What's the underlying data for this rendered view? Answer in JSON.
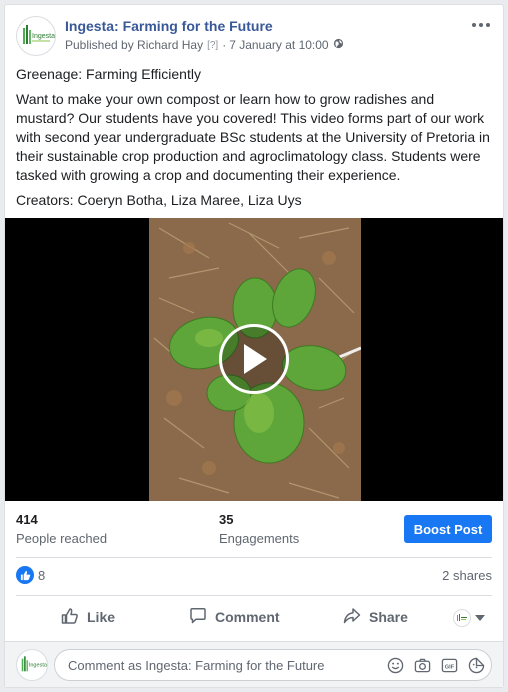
{
  "post": {
    "page_name": "Ingesta: Farming for the Future",
    "published_by": "Published by Richard Hay",
    "help_marker": "[?]",
    "separator": "·",
    "date": "7 January at 10:00",
    "title_line": "Greenage: Farming Efficiently",
    "body": "Want to make your own compost or learn how to grow radishes and mustard? Our students have you covered! This video forms part of our work with second year undergraduate BSc students at the University of Pretoria in their sustainable crop production and agroclimatology class. Students were tasked with growing a crop and documenting their experience.",
    "creators": "Creators: Coeryn Botha, Liza Maree, Liza Uys",
    "avatar_logo_text": "Ingesta"
  },
  "video": {
    "play_icon": "play-icon"
  },
  "stats": {
    "reach_value": "414",
    "reach_label": "People reached",
    "engagement_value": "35",
    "engagement_label": "Engagements",
    "boost_label": "Boost Post"
  },
  "reactions": {
    "like_count": "8",
    "shares": "2 shares"
  },
  "actions": {
    "like": "Like",
    "comment": "Comment",
    "share": "Share"
  },
  "composer": {
    "placeholder": "Comment as Ingesta: Farming for the Future"
  },
  "colors": {
    "link": "#385898",
    "accent": "#1877f2"
  }
}
